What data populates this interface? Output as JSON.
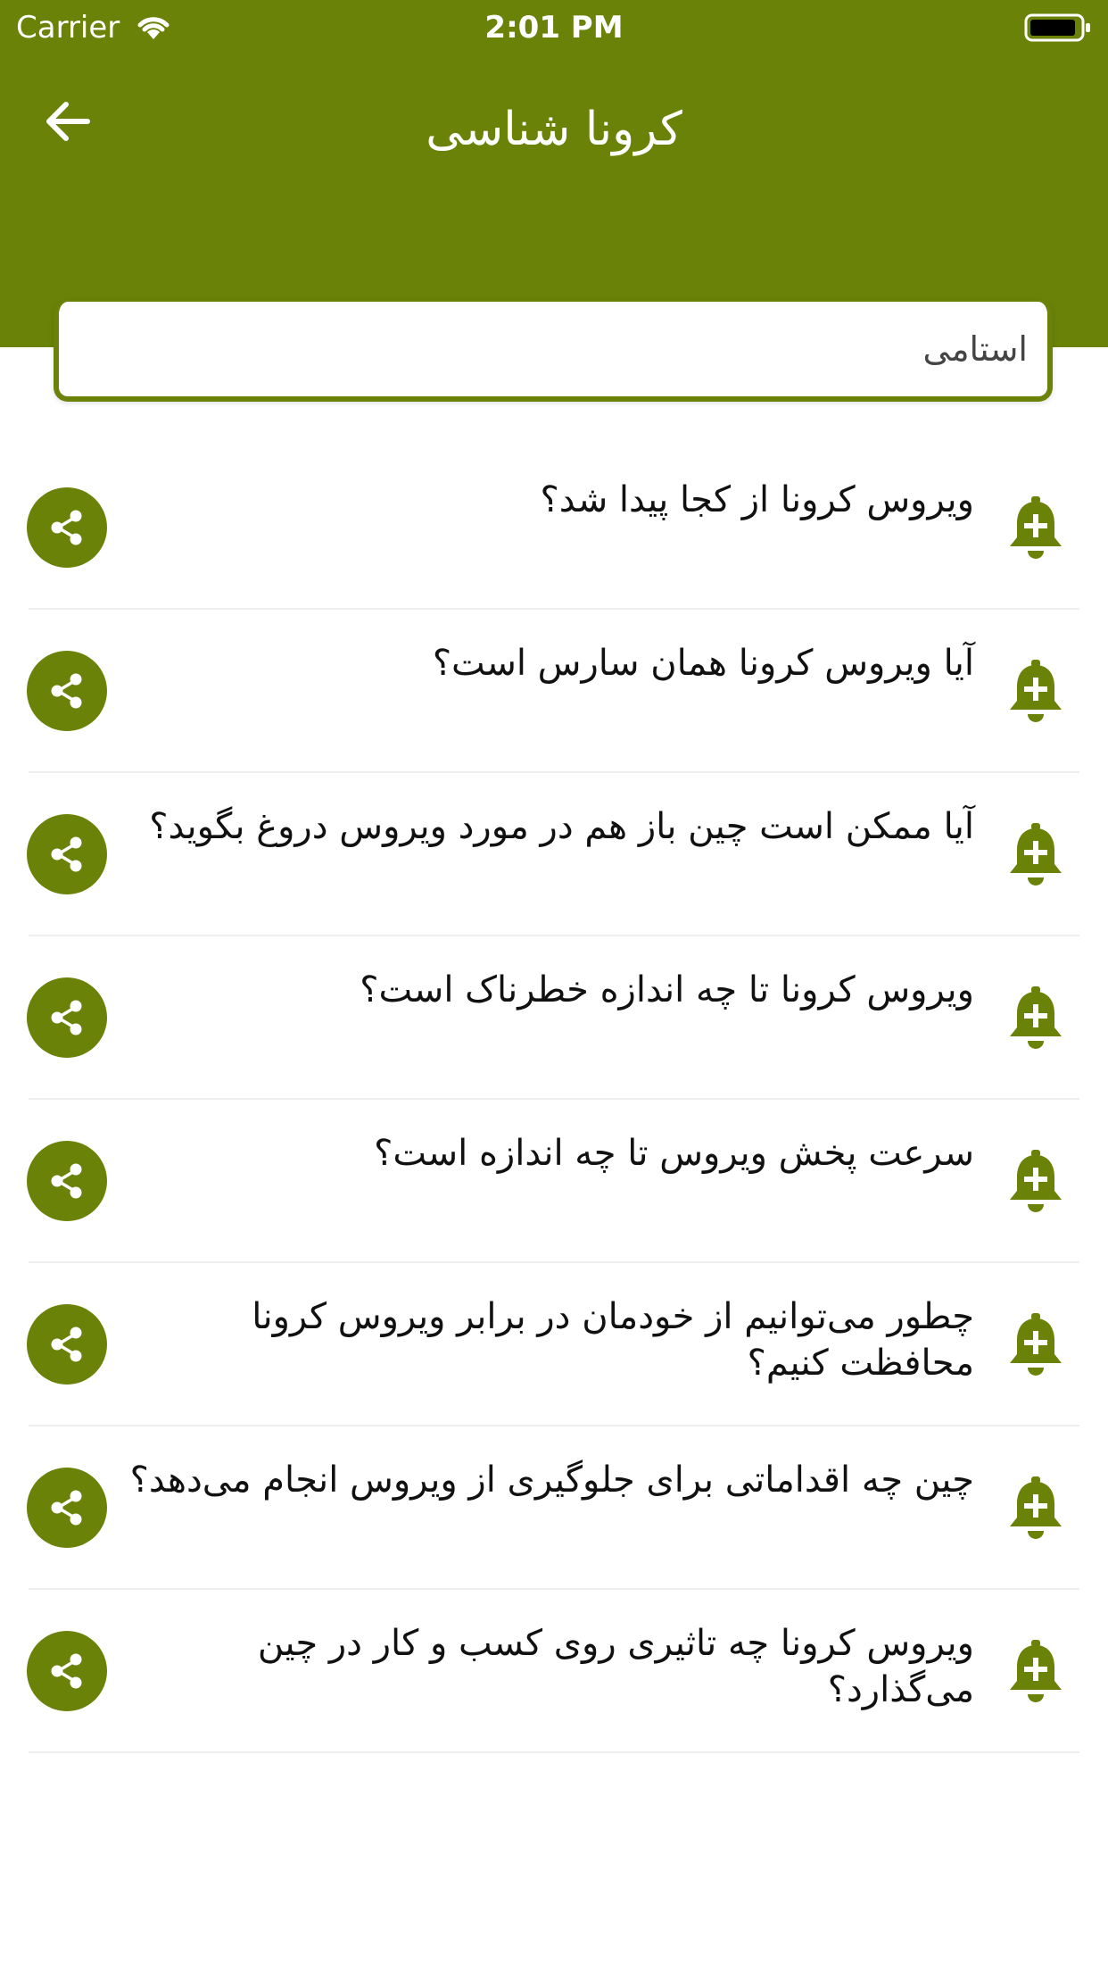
{
  "status_bar": {
    "carrier": "Carrier",
    "time": "2:01 PM"
  },
  "header": {
    "title": "کرونا شناسی",
    "back_icon": "arrow-left-icon"
  },
  "search": {
    "value": "استامی",
    "placeholder": ""
  },
  "colors": {
    "brand": "#6a8208",
    "divider": "#eeeeee",
    "text": "#111111"
  },
  "icons": {
    "share": "share-icon",
    "bell": "bell-plus-icon"
  },
  "questions": [
    "ویروس کرونا از کجا پیدا شد؟",
    "آیا ویروس کرونا همان سارس است؟",
    "آیا ممکن است چین باز هم در مورد ویروس دروغ بگوید؟",
    "ویروس کرونا تا چه اندازه خطرناک است؟",
    "سرعت پخش ویروس تا چه اندازه است؟",
    "چطور می‌توانیم از خودمان در برابر ویروس کرونا محافظت کنیم؟",
    "چین چه اقداماتی برای جلوگیری از ویروس انجام می‌دهد؟",
    "ویروس کرونا چه تاثیری روی کسب و کار در چین می‌گذارد؟"
  ]
}
